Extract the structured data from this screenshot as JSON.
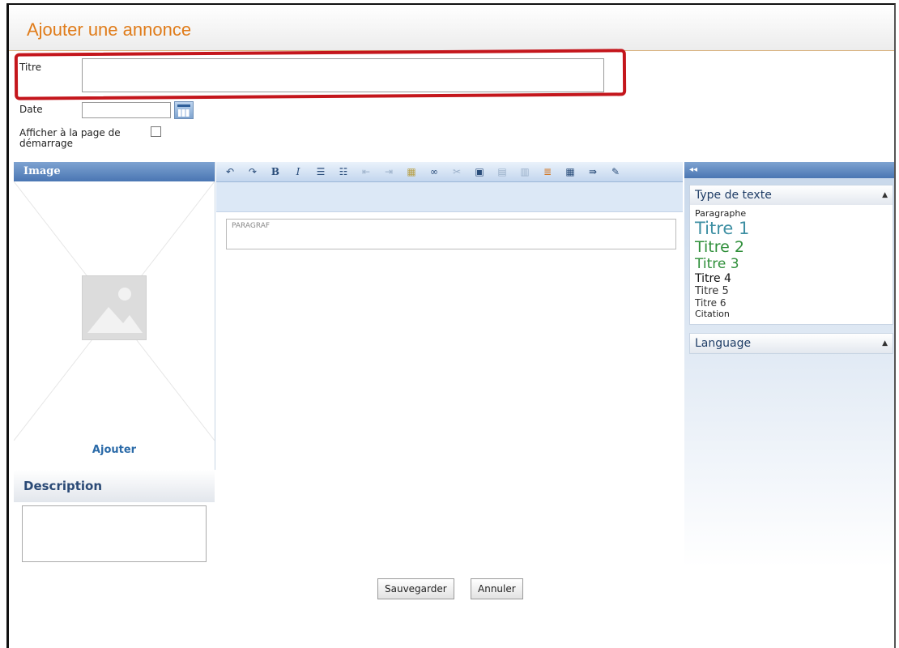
{
  "header": {
    "title": "Ajouter une annonce"
  },
  "form": {
    "titre_label": "Titre",
    "titre_value": "",
    "date_label": "Date",
    "date_value": "",
    "startpage_label": "Afficher à la page de démarrage",
    "startpage_checked": false
  },
  "image_panel": {
    "header": "Image",
    "add_label": "Ajouter"
  },
  "description_panel": {
    "header": "Description",
    "value": ""
  },
  "editor": {
    "toolbar_icons": [
      "undo-icon",
      "redo-icon",
      "bold-icon",
      "italic-icon",
      "ordered-list-icon",
      "unordered-list-icon",
      "outdent-icon",
      "indent-icon",
      "paste-icon",
      "link-icon",
      "unlink-icon",
      "insert-image-icon",
      "align-left-icon",
      "align-center-icon",
      "align-right-icon",
      "table-icon",
      "format-icon",
      "eraser-icon"
    ],
    "paragraph_placeholder": "PARAGRAF"
  },
  "right_panel": {
    "collapse_glyph": "◂◂",
    "type_header": "Type de texte",
    "types": [
      "Paragraphe",
      "Titre 1",
      "Titre 2",
      "Titre 3",
      "Titre 4",
      "Titre 5",
      "Titre 6",
      "Citation"
    ],
    "language_header": "Language"
  },
  "buttons": {
    "save": "Sauvegarder",
    "cancel": "Annuler"
  },
  "colors": {
    "title_orange": "#e07c1a",
    "highlight_red": "#c4161c",
    "panel_blue": "#4a76b3"
  }
}
